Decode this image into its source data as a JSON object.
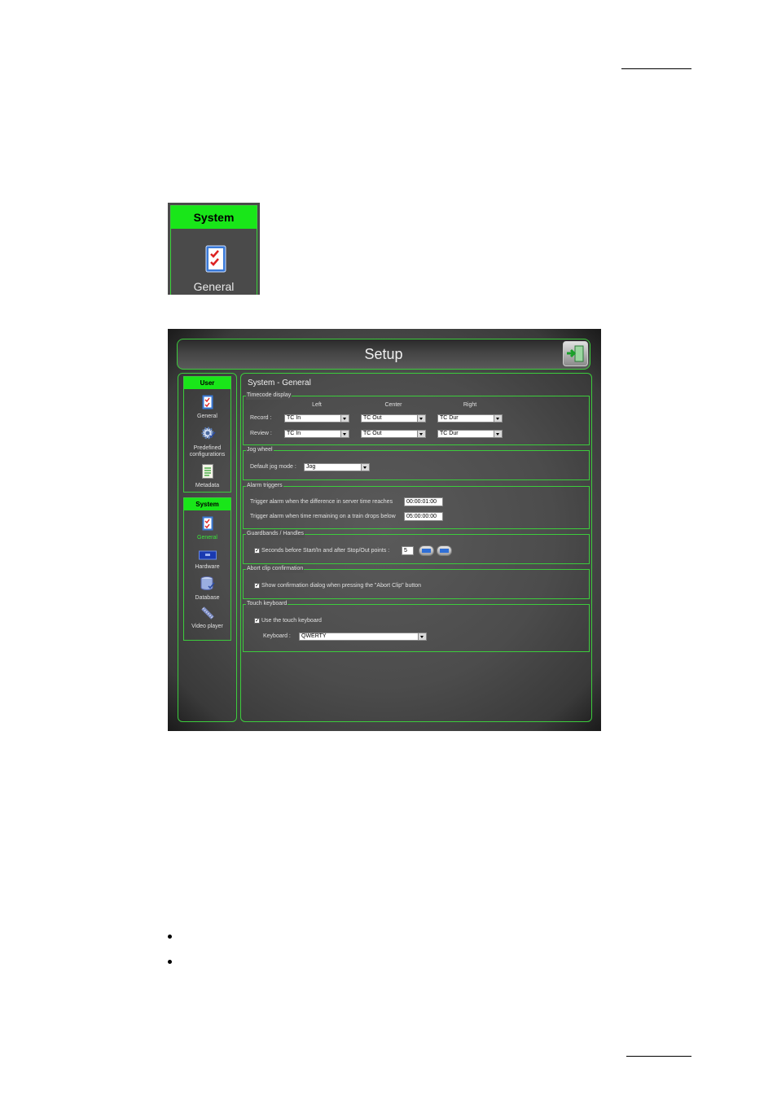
{
  "thumbnail": {
    "header": "System",
    "icon": "checklist-icon",
    "label": "General"
  },
  "window": {
    "title": "Setup",
    "exit_icon": "exit-door-icon",
    "sidebar": {
      "user_group": {
        "header": "User",
        "items": [
          {
            "label": "General",
            "icon": "checklist-icon"
          },
          {
            "label": "Predefined configurations",
            "icon": "gear-icon"
          },
          {
            "label": "Metadata",
            "icon": "document-icon"
          }
        ]
      },
      "system_group": {
        "header": "System",
        "items": [
          {
            "label": "General",
            "icon": "checklist-icon",
            "active": true
          },
          {
            "label": "Hardware",
            "icon": "card-icon"
          },
          {
            "label": "Database",
            "icon": "database-icon"
          },
          {
            "label": "Video player",
            "icon": "film-icon"
          }
        ]
      }
    },
    "main": {
      "title": "System - General",
      "timecode": {
        "legend": "Timecode display",
        "col_left": "Left",
        "col_center": "Center",
        "col_right": "Right",
        "record_label": "Record :",
        "review_label": "Review :",
        "record": [
          "TC In",
          "TC Out",
          "TC Dur"
        ],
        "review": [
          "TC In",
          "TC Out",
          "TC Dur"
        ]
      },
      "jog": {
        "legend": "Jog wheel",
        "label": "Default jog mode :",
        "value": "Jog"
      },
      "alarm": {
        "legend": "Alarm triggers",
        "line1": "Trigger alarm when the difference in server time reaches",
        "value1": "00:00:01:00",
        "line2": "Trigger alarm when time remaining on a train drops below",
        "value2": "05:00:00:00"
      },
      "guardbands": {
        "legend": "Guardbands / Handles",
        "label": "Seconds before Start/In and after Stop/Out points :",
        "value": "5",
        "checked": true
      },
      "abort": {
        "legend": "Abort clip confirmation",
        "label": "Show confirmation dialog when pressing the \"Abort Clip\" button",
        "checked": true
      },
      "touch": {
        "legend": "Touch keyboard",
        "label": "Use the touch keyboard",
        "checked": true,
        "keyboard_label": "Keyboard :",
        "keyboard_value": "QWERTY"
      }
    }
  },
  "colors": {
    "accent_green": "#19e619",
    "border_green": "#3ccc3c",
    "panel_gray": "#4f4f4f"
  }
}
